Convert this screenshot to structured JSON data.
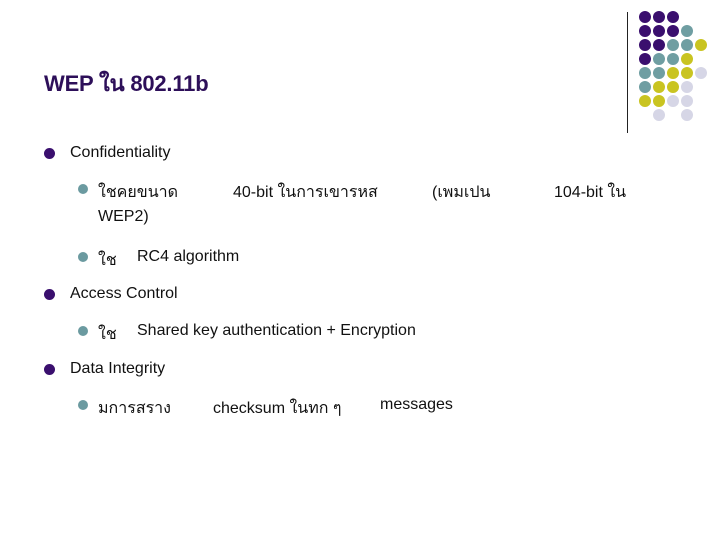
{
  "slide": {
    "title": "WEP ใน 802.11b",
    "colors": {
      "title": "#2d0f59",
      "bullet_level1": "#3a0f6e",
      "bullet_level2": "#6b9aa0"
    },
    "bullets": [
      {
        "label": "Confidentiality",
        "children": [
          {
            "segments": [
              "ใชคยขนาด",
              "40-bit  ในการเขารหส",
              "(เพมเปน",
              "104-bit ใน"
            ],
            "continuation": "WEP2)"
          },
          {
            "segments": [
              "ใช",
              "RC4 algorithm"
            ]
          }
        ]
      },
      {
        "label": "Access Control",
        "children": [
          {
            "segments": [
              "ใช",
              "Shared key  authentication + Encryption"
            ]
          }
        ]
      },
      {
        "label": "Data Integrity",
        "children": [
          {
            "segments": [
              "มการสราง",
              "checksum ในทก ๆ",
              "messages"
            ]
          }
        ]
      }
    ]
  },
  "decoration": {
    "dot_palette": {
      "P": "#3a0f6e",
      "T": "#6f9ea2",
      "Y": "#c9c421",
      "L": "#d6d6e6"
    },
    "dot_rows": [
      "PPP",
      "PPPT",
      "PPTTY",
      "PTTY",
      "TTYYL",
      "TYYL",
      "YYLL",
      "_L_L"
    ]
  }
}
